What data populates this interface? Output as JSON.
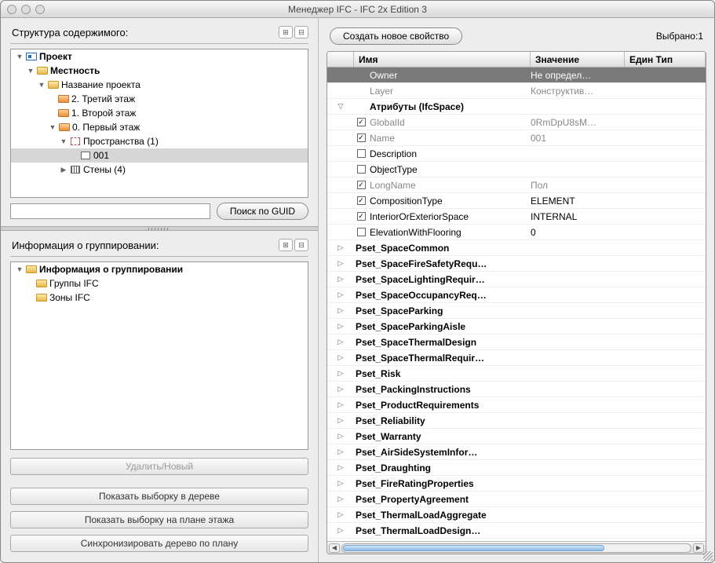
{
  "window": {
    "title": "Менеджер IFC - IFC 2x Edition 3"
  },
  "left": {
    "structure_label": "Структура содержимого:",
    "group_label": "Информация о группировании:",
    "search_btn": "Поиск по GUID",
    "delete_new": "Удалить/Новый",
    "show_tree": "Показать выборку в дереве",
    "show_plan": "Показать выборку на плане этажа",
    "sync": "Синхронизировать дерево по плану",
    "tree": {
      "project": "Проект",
      "site": "Местность",
      "building": "Название проекта",
      "floor2": "2. Третий этаж",
      "floor1": "1. Второй этаж",
      "floor0": "0. Первый этаж",
      "spaces": "Пространства (1)",
      "room": "001",
      "walls": "Стены (4)"
    },
    "groups": {
      "root": "Информация о группировании",
      "ifc_groups": "Группы IFC",
      "ifc_zones": "Зоны IFC"
    }
  },
  "right": {
    "create_btn": "Создать новое свойство",
    "selected": "Выбрано:1",
    "headers": {
      "name": "Имя",
      "value": "Значение",
      "unit": "Един Тип"
    },
    "rows_top": [
      {
        "name": "Owner",
        "value": "Не определ…",
        "dark": true
      },
      {
        "name": "Layer",
        "value": "Конструктив…",
        "gray": true
      }
    ],
    "attr_header": "Атрибуты (IfcSpace)",
    "attrs": [
      {
        "name": "GlobalId",
        "value": "0RmDpU8sM…",
        "checked": true,
        "gray": true
      },
      {
        "name": "Name",
        "value": "001",
        "checked": true,
        "gray": true
      },
      {
        "name": "Description",
        "value": "",
        "checked": false
      },
      {
        "name": "ObjectType",
        "value": "",
        "checked": false
      },
      {
        "name": "LongName",
        "value": "Пол",
        "checked": true,
        "gray": true
      },
      {
        "name": "CompositionType",
        "value": "ELEMENT",
        "checked": true
      },
      {
        "name": "InteriorOrExteriorSpace",
        "value": "INTERNAL",
        "checked": true
      },
      {
        "name": "ElevationWithFlooring",
        "value": "0",
        "checked": false
      }
    ],
    "psets": [
      "Pset_SpaceCommon",
      "Pset_SpaceFireSafetyRequ…",
      "Pset_SpaceLightingRequir…",
      "Pset_SpaceOccupancyReq…",
      "Pset_SpaceParking",
      "Pset_SpaceParkingAisle",
      "Pset_SpaceThermalDesign",
      "Pset_SpaceThermalRequir…",
      "Pset_Risk",
      "Pset_PackingInstructions",
      "Pset_ProductRequirements",
      "Pset_Reliability",
      "Pset_Warranty",
      "Pset_AirSideSystemInfor…",
      "Pset_Draughting",
      "Pset_FireRatingProperties",
      "Pset_PropertyAgreement",
      "Pset_ThermalLoadAggregate",
      "Pset_ThermalLoadDesign…"
    ]
  }
}
